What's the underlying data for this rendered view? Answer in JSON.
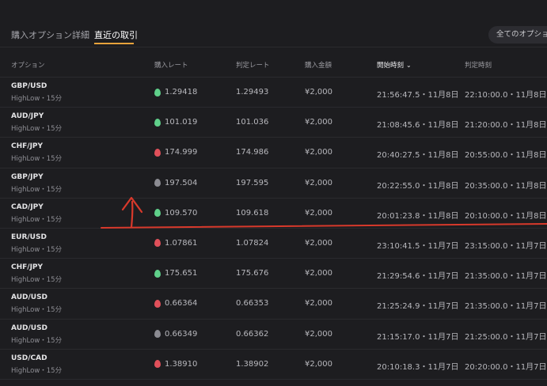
{
  "tabs": {
    "purchase_options": "購入オプション詳細",
    "recent_trades": "直近の取引"
  },
  "filter": {
    "label": "全てのオプショ"
  },
  "columns": {
    "option": "オプション",
    "buy_rate": "購入レート",
    "judge_rate": "判定レート",
    "amount": "購入金額",
    "start_time": "開始時刻",
    "judge_time": "判定時刻"
  },
  "rows": [
    {
      "pair": "GBP/USD",
      "type": "HighLow・15分",
      "direction": "green",
      "buy_rate": "1.29418",
      "judge_rate": "1.29493",
      "amount": "¥2,000",
      "start": "21:56:47.5・11月8日",
      "judge": "22:10:00.0・11月8日"
    },
    {
      "pair": "AUD/JPY",
      "type": "HighLow・15分",
      "direction": "green",
      "buy_rate": "101.019",
      "judge_rate": "101.036",
      "amount": "¥2,000",
      "start": "21:08:45.6・11月8日",
      "judge": "21:20:00.0・11月8日"
    },
    {
      "pair": "CHF/JPY",
      "type": "HighLow・15分",
      "direction": "red",
      "buy_rate": "174.999",
      "judge_rate": "174.986",
      "amount": "¥2,000",
      "start": "20:40:27.5・11月8日",
      "judge": "20:55:00.0・11月8日"
    },
    {
      "pair": "GBP/JPY",
      "type": "HighLow・15分",
      "direction": "gray",
      "buy_rate": "197.504",
      "judge_rate": "197.595",
      "amount": "¥2,000",
      "start": "20:22:55.0・11月8日",
      "judge": "20:35:00.0・11月8日"
    },
    {
      "pair": "CAD/JPY",
      "type": "HighLow・15分",
      "direction": "green",
      "buy_rate": "109.570",
      "judge_rate": "109.618",
      "amount": "¥2,000",
      "start": "20:01:23.8・11月8日",
      "judge": "20:10:00.0・11月8日"
    },
    {
      "pair": "EUR/USD",
      "type": "HighLow・15分",
      "direction": "red",
      "buy_rate": "1.07861",
      "judge_rate": "1.07824",
      "amount": "¥2,000",
      "start": "23:10:41.5・11月7日",
      "judge": "23:15:00.0・11月7日"
    },
    {
      "pair": "CHF/JPY",
      "type": "HighLow・15分",
      "direction": "green",
      "buy_rate": "175.651",
      "judge_rate": "175.676",
      "amount": "¥2,000",
      "start": "21:29:54.6・11月7日",
      "judge": "21:35:00.0・11月7日"
    },
    {
      "pair": "AUD/USD",
      "type": "HighLow・15分",
      "direction": "red",
      "buy_rate": "0.66364",
      "judge_rate": "0.66353",
      "amount": "¥2,000",
      "start": "21:25:24.9・11月7日",
      "judge": "21:35:00.0・11月7日"
    },
    {
      "pair": "AUD/USD",
      "type": "HighLow・15分",
      "direction": "gray",
      "buy_rate": "0.66349",
      "judge_rate": "0.66362",
      "amount": "¥2,000",
      "start": "21:15:17.0・11月7日",
      "judge": "21:25:00.0・11月7日"
    },
    {
      "pair": "USD/CAD",
      "type": "HighLow・15分",
      "direction": "red",
      "buy_rate": "1.38910",
      "judge_rate": "1.38902",
      "amount": "¥2,000",
      "start": "20:10:18.3・11月7日",
      "judge": "20:20:00.0・11月7日"
    }
  ],
  "colors": {
    "green": "#5fd08a",
    "red": "#e0505a",
    "gray": "#8b8b92",
    "accent": "#e7a33b",
    "annotation": "#d8392b"
  },
  "icons": {
    "direction": "drop-icon",
    "sort": "chevron-down-icon",
    "annotation_arrow": "hand-drawn-arrow-up"
  }
}
